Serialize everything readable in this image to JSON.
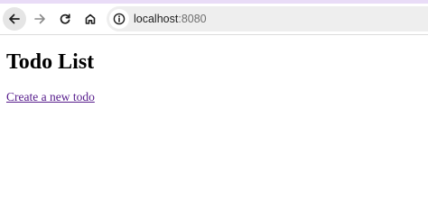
{
  "browser": {
    "address_bar": {
      "host": "localhost",
      "port": ":8080"
    }
  },
  "page": {
    "title": "Todo List",
    "create_link_label": "Create a new todo"
  },
  "colors": {
    "top_strip": "#e9dcf7",
    "visited_link": "#551a8b"
  },
  "icons": {
    "back": "arrow-left-icon",
    "forward": "arrow-right-icon",
    "reload": "reload-icon",
    "home": "home-icon",
    "site_info": "info-icon"
  }
}
